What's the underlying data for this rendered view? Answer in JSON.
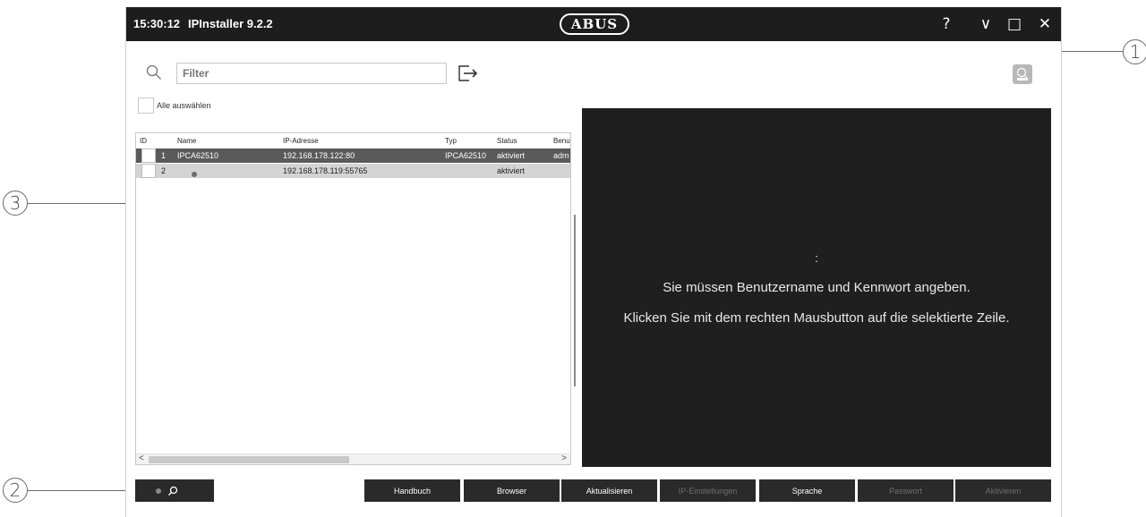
{
  "titlebar": {
    "time": "15:30:12",
    "title": "IPInstaller 9.2.2",
    "logo": "ABUS",
    "buttons": [
      {
        "name": "help-button",
        "glyph": "?"
      },
      {
        "name": "minimize-button",
        "glyph": "∨"
      },
      {
        "name": "maximize-button",
        "glyph": "□"
      },
      {
        "name": "close-button",
        "glyph": "✕"
      }
    ]
  },
  "toolbar": {
    "search_icon": "search-icon",
    "filter_placeholder": "Filter",
    "export_icon": "export-icon",
    "ip_icon": "ip-camera-icon"
  },
  "select_all_label": "Alle auswählen",
  "table": {
    "columns": [
      "ID",
      "Name",
      "IP-Adresse",
      "Typ",
      "Status",
      "Benut"
    ],
    "rows": [
      {
        "id": "1",
        "name": "IPCA62510",
        "ip": "192.168.178.122:80",
        "type": "IPCA62510",
        "status": "aktiviert",
        "user": "adm",
        "selected": true
      },
      {
        "id": "2",
        "name": "",
        "ip": "192.168.178.119:55765",
        "type": "",
        "status": "aktiviert",
        "user": "",
        "selected": false
      }
    ],
    "scroll_left": "<",
    "scroll_right": ">"
  },
  "info_panel": {
    "colon": ":",
    "line1": "Sie müssen Benutzername und Kennwort angeben.",
    "line2": "Klicken Sie mit dem rechten Mausbutton auf die selektierte Zeile."
  },
  "buttons": [
    {
      "label": "Handbuch",
      "enabled": true
    },
    {
      "label": "Browser",
      "enabled": true
    },
    {
      "label": "Aktualisieren",
      "enabled": true
    },
    {
      "label": "IP-Einstellungen",
      "enabled": false
    },
    {
      "label": "Sprache",
      "enabled": true
    },
    {
      "label": "Passwort",
      "enabled": false
    },
    {
      "label": "Aktivieren",
      "enabled": false
    }
  ],
  "callouts": {
    "c1": "1",
    "c2": "2",
    "c3": "3"
  },
  "colors": {
    "titlebar": "#1d1d1d",
    "selected_row": "#5a5a5a",
    "secondary_row": "#d4d4d4",
    "panel": "#1f1f1f",
    "button": "#2a2a2a"
  }
}
